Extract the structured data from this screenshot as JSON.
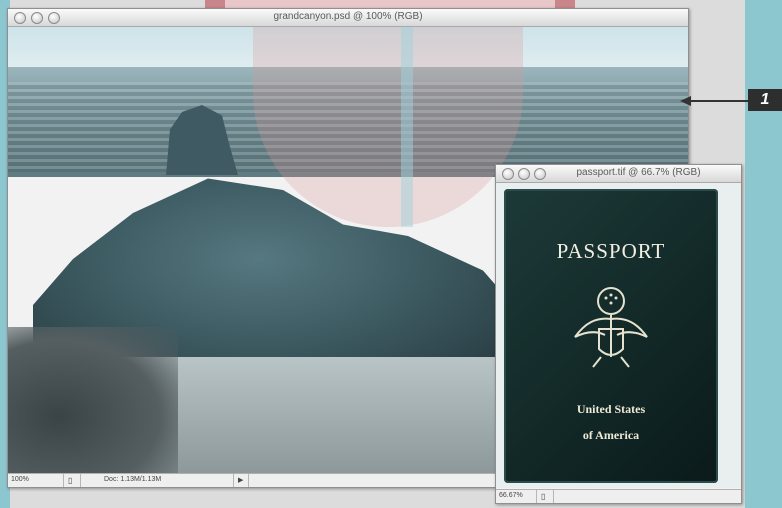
{
  "windows": {
    "grandcanyon": {
      "title": "grandcanyon.psd @ 100% (RGB)",
      "status": {
        "zoom": "100%",
        "doc_info": "Doc: 1.13M/1.13M"
      }
    },
    "passport": {
      "title": "passport.tif @ 66.7% (RGB)",
      "status": {
        "zoom": "66.67%"
      },
      "cover": {
        "heading": "PASSPORT",
        "line1": "United States",
        "line2": "of America"
      }
    }
  },
  "callout": {
    "number": "1"
  },
  "colors": {
    "accent": "#8cc7cf",
    "callout_bg": "#2e2e2e"
  }
}
